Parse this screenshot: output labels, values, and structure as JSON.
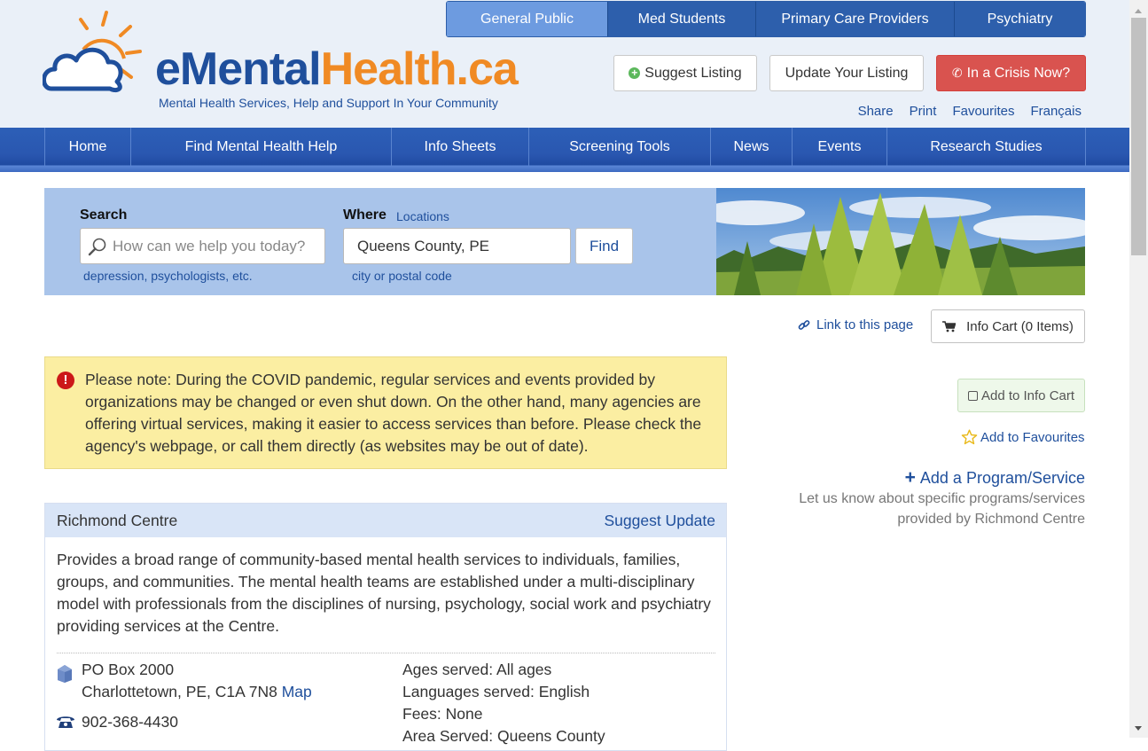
{
  "header": {
    "logo_text_e": "eMental",
    "logo_text_h": "Health.ca",
    "tagline": "Mental Health Services, Help and Support In Your Community",
    "audience_tabs": [
      "General Public",
      "Med Students",
      "Primary Care Providers",
      "Psychiatry"
    ],
    "suggest_listing": "Suggest Listing",
    "update_listing": "Update Your Listing",
    "crisis": "In a Crisis Now?",
    "utility_links": [
      "Share",
      "Print",
      "Favourites",
      "Français"
    ]
  },
  "nav": {
    "items": [
      "Home",
      "Find Mental Health Help",
      "Info Sheets",
      "Screening Tools",
      "News",
      "Events",
      "Research Studies"
    ]
  },
  "search": {
    "search_label": "Search",
    "search_placeholder": "How can we help you today?",
    "search_hint": "depression, psychologists, etc.",
    "where_label": "Where",
    "locations_link": "Locations",
    "where_value": "Queens County, PE",
    "where_hint": "city or postal code",
    "find_button": "Find"
  },
  "toolbar": {
    "link_to_page": "Link to this page",
    "info_cart": "Info Cart (0 Items)"
  },
  "alert": {
    "text": "Please note: During the COVID pandemic, regular services and events provided by organizations may be changed or even shut down. On the other hand, many agencies are offering virtual services, making it easier to access services than before. Please check the agency's webpage, or call them directly (as websites may be out of date)."
  },
  "sidebar": {
    "add_to_cart": "Add to Info Cart",
    "add_to_favourites": "Add to Favourites",
    "add_program": "Add a Program/Service",
    "program_note": "Let us know about specific programs/services provided by Richmond Centre"
  },
  "listing": {
    "title": "Richmond Centre",
    "suggest_update": "Suggest Update",
    "description": "Provides a broad range of community-based mental health services to individuals, families, groups, and communities. The mental health teams are established under a multi-disciplinary model with professionals from the disciplines of nursing, psychology, social work and psychiatry providing services at the Centre.",
    "address_line1": "PO Box 2000",
    "address_line2": "Charlottetown, PE, C1A 7N8",
    "map_link": "Map",
    "phone": "902-368-4430",
    "ages": "Ages served: All ages",
    "languages": "Languages served: English",
    "fees": "Fees: None",
    "area": "Area Served: Queens County"
  },
  "colors": {
    "brand_blue": "#1f4f9c",
    "brand_orange": "#f08a24",
    "nav_blue": "#2a57b0",
    "crisis_red": "#d9534f",
    "search_panel": "#a9c4ea",
    "alert_yellow": "#fbeea2"
  },
  "icons": [
    "sun-cloud-logo",
    "plus-circle-icon",
    "phone-icon",
    "search-icon",
    "link-icon",
    "cart-icon",
    "exclamation-icon",
    "checkbox-icon",
    "star-icon",
    "plus-icon",
    "house-icon",
    "telephone-icon"
  ]
}
